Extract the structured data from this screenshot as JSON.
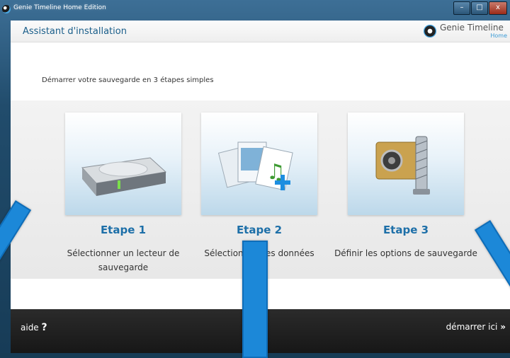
{
  "window": {
    "title": "Genie Timeline Home Edition",
    "controls": {
      "minimize": "–",
      "maximize": "□",
      "close": "x"
    }
  },
  "header": {
    "title": "Assistant d'installation",
    "logo_name": "Genie Timeline",
    "logo_sub": "Home"
  },
  "subtitle": "Démarrer votre sauvegarde en 3 étapes simples",
  "steps": [
    {
      "title": "Etape 1",
      "desc": "Sélectionner un lecteur de sauvegarde",
      "icon": "hard-drive-icon"
    },
    {
      "title": "Etape 2",
      "desc": "Sélectionner des données",
      "icon": "files-icon"
    },
    {
      "title": "Etape 3",
      "desc": "Définir les options de sauvegarde",
      "icon": "locked-archive-icon"
    }
  ],
  "footer": {
    "help_label": "aide",
    "help_icon": "?",
    "start_label": "démarrer ici",
    "start_icon": "»"
  },
  "colors": {
    "accent": "#1d6fa8",
    "arrow": "#1c88d8",
    "footer": "#1f1f1f"
  }
}
